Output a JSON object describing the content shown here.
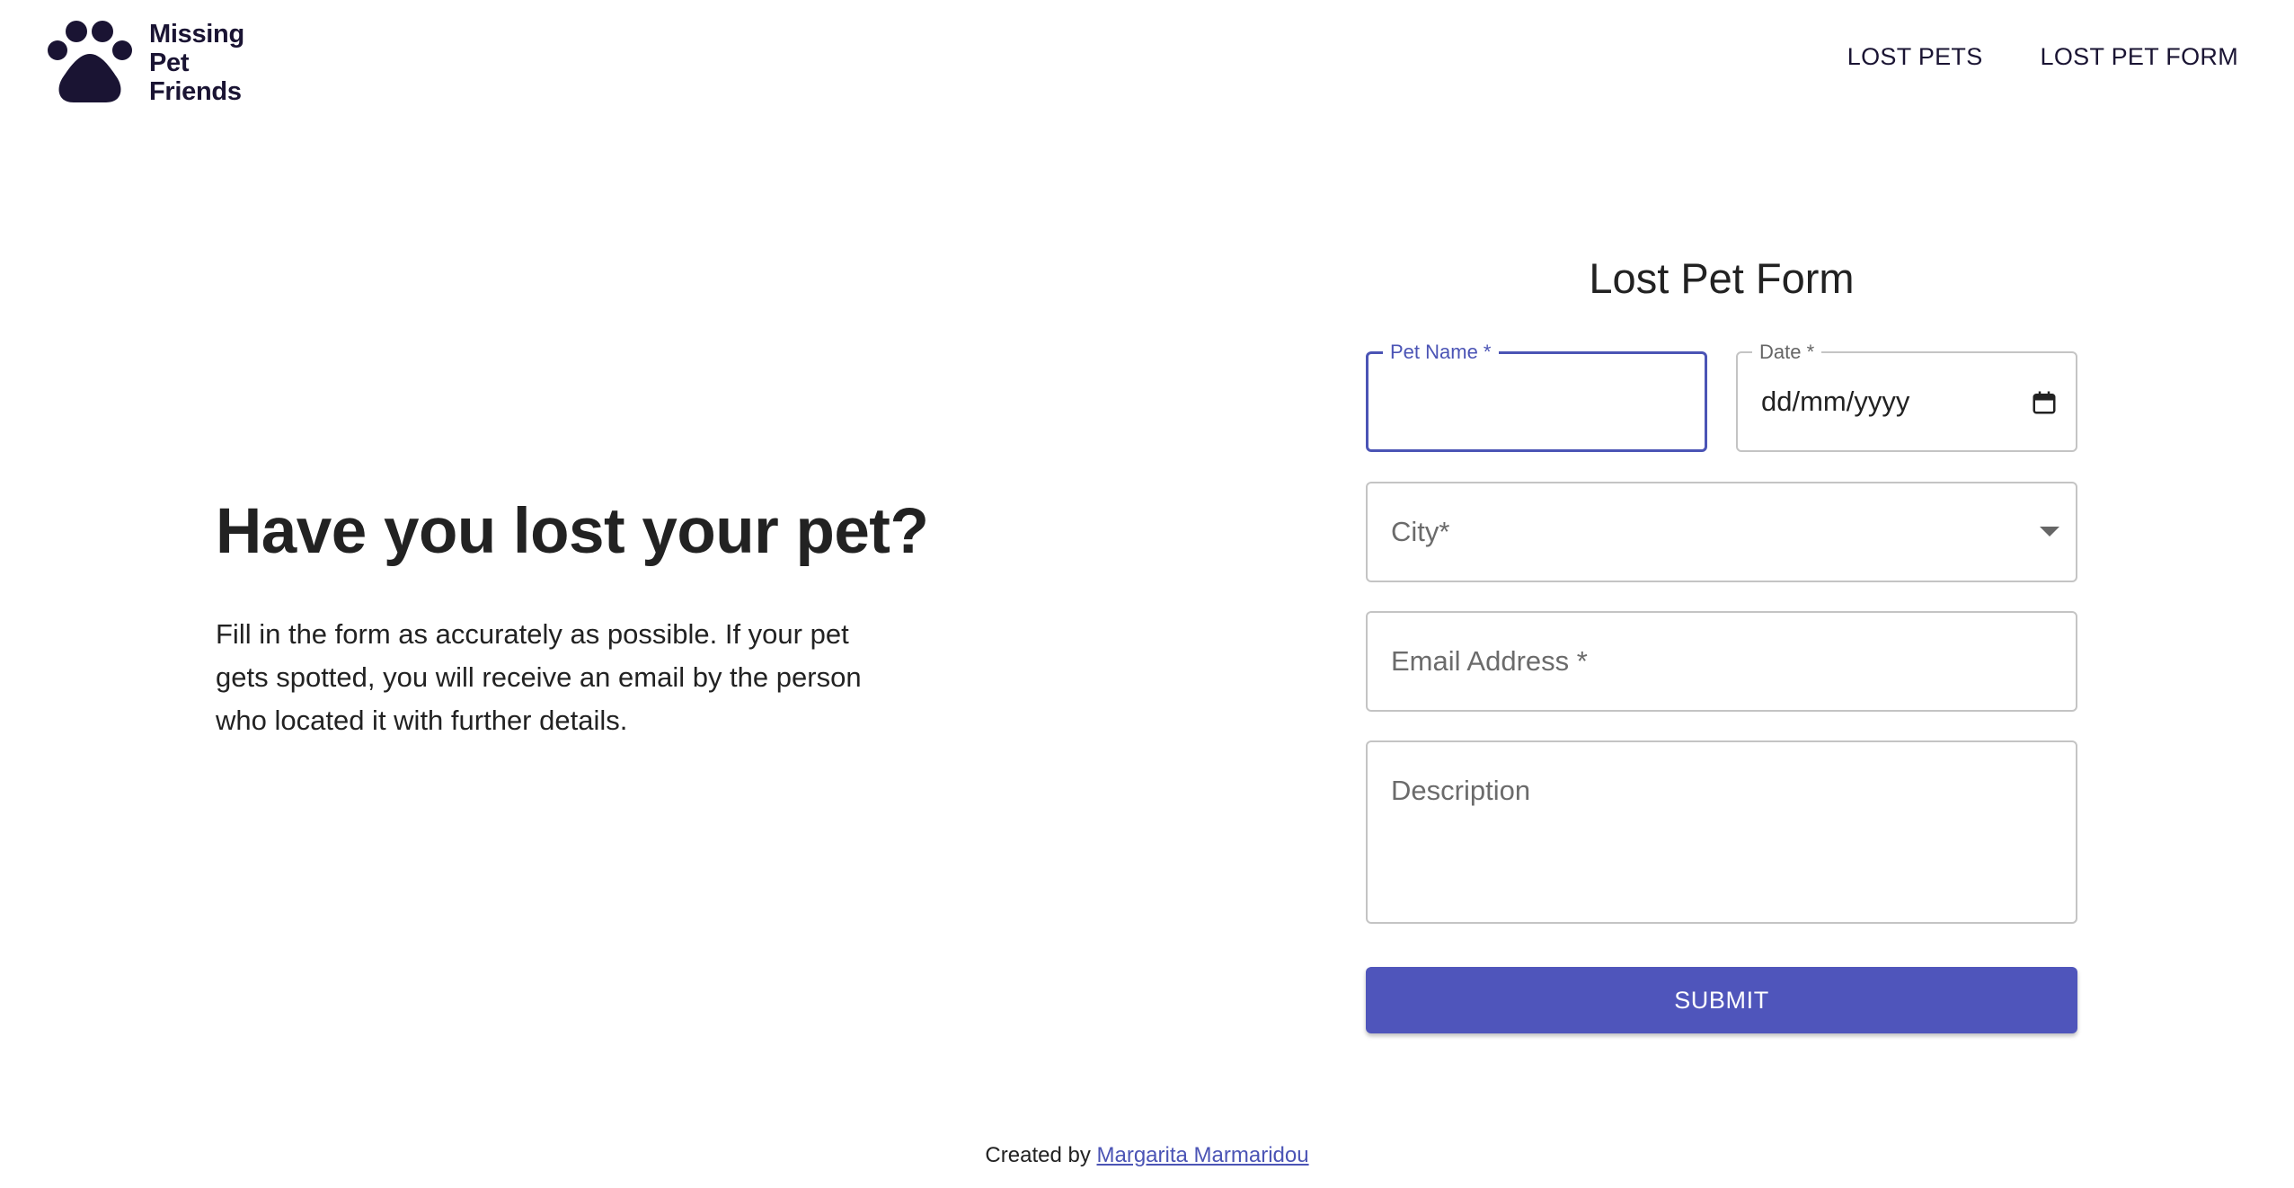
{
  "brand": {
    "logo_icon": "paw-icon",
    "name_lines": [
      "Missing",
      "Pet",
      "Friends"
    ],
    "color": "#1a1433"
  },
  "nav": {
    "items": [
      {
        "label": "LOST PETS"
      },
      {
        "label": "LOST PET FORM"
      }
    ]
  },
  "hero": {
    "title": "Have you lost your pet?",
    "description": "Fill in the form as accurately as possible. If your pet gets spotted, you will receive an email by the person who located it with further details."
  },
  "form": {
    "title": "Lost Pet Form",
    "pet_name": {
      "label": "Pet Name *",
      "value": ""
    },
    "date": {
      "label": "Date *",
      "placeholder": "dd/mm/yyyy"
    },
    "city": {
      "placeholder": "City*"
    },
    "email": {
      "placeholder": "Email Address *"
    },
    "description": {
      "placeholder": "Description"
    },
    "submit_label": "SUBMIT",
    "accent_color": "#4f55bb"
  },
  "footer": {
    "prefix": "Created by",
    "author": "Margarita Marmaridou"
  }
}
